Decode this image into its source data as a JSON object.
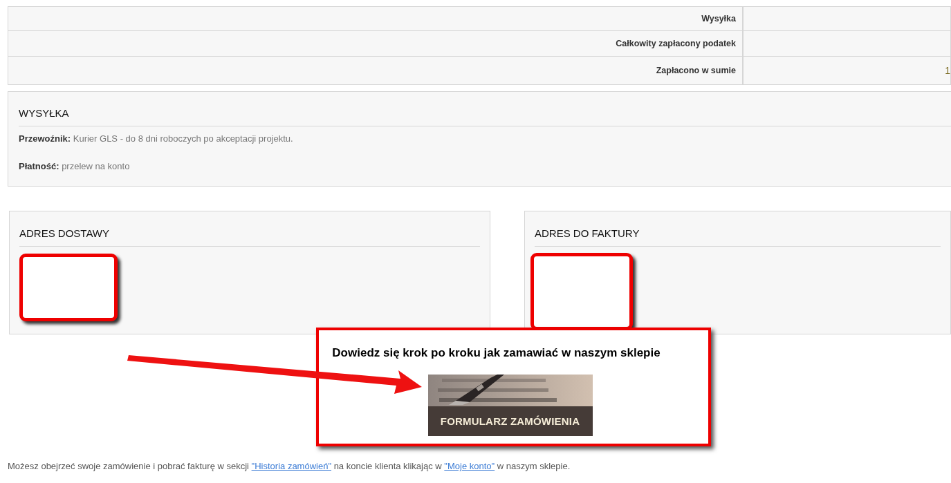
{
  "totals": [
    {
      "label": "Wysyłka"
    },
    {
      "label": "Całkowity zapłacony podatek"
    },
    {
      "label": "Zapłacono w sumie",
      "value": "1"
    }
  ],
  "shipping": {
    "title": "WYSYŁKA",
    "lines": [
      {
        "label": "Przewoźnik:",
        "text": "Kurier GLS - do 8 dni roboczych po akceptacji projektu."
      },
      {
        "label": "Płatność:",
        "text": "przelew na konto"
      }
    ]
  },
  "addresses": [
    {
      "title": "ADRES DOSTAWY",
      "redacted": true
    },
    {
      "title": "ADRES DO FAKTURY",
      "redacted": true
    }
  ],
  "promo": {
    "heading": "Dowiedz się krok po kroku jak zamawiać w naszym sklepie",
    "banner": {
      "kind": "picture",
      "caption": "FORMULARZ ZAMÓWIENIA"
    }
  },
  "footer_note": [
    {
      "kind": "text",
      "text": "Możesz obejrzeć swoje zamówienie i pobrać fakturę w sekcji "
    },
    {
      "kind": "link",
      "text": "\"Historia zamówień\""
    },
    {
      "kind": "text",
      "text": " na koncie klienta klikając w "
    },
    {
      "kind": "link",
      "text": "\"Moje konto\""
    },
    {
      "kind": "text",
      "text": " w naszym sklepie."
    }
  ]
}
